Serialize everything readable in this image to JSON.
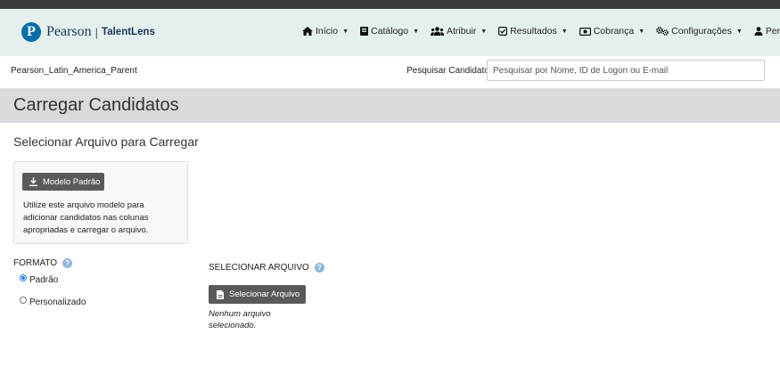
{
  "brand": {
    "name": "Pearson",
    "logo_letter": "P",
    "separator": "|",
    "product": "TalentLens"
  },
  "nav": {
    "items": [
      {
        "label": "Início",
        "icon": "home-icon"
      },
      {
        "label": "Catálogo",
        "icon": "book-icon"
      },
      {
        "label": "Atribuir",
        "icon": "users-icon"
      },
      {
        "label": "Resultados",
        "icon": "checkbox-icon"
      },
      {
        "label": "Cobrança",
        "icon": "money-icon"
      },
      {
        "label": "Configurações",
        "icon": "gears-icon"
      },
      {
        "label": "Perfil",
        "icon": "user-icon"
      }
    ]
  },
  "subbar": {
    "org_name": "Pearson_Latin_America_Parent",
    "search_label": "Pesquisar Candidatos",
    "search_placeholder": "Pesquisar por Nome, ID de Logon ou E-mail",
    "search_value": ""
  },
  "page": {
    "title": "Carregar Candidatos",
    "section_title": "Selecionar Arquivo para Carregar"
  },
  "template": {
    "button_label": "Modelo Padrão",
    "description": "Utilize este arquivo modelo para adicionar candidatos nas colunas apropriadas e carregar o arquivo."
  },
  "format": {
    "label": "FORMATO",
    "help": "?",
    "options": [
      {
        "label": "Padrão",
        "checked": true
      },
      {
        "label": "Personalizado",
        "checked": false
      }
    ]
  },
  "file_select": {
    "label": "SELECIONAR ARQUIVO",
    "help": "?",
    "button_label": "Selecionar Arquivo",
    "status": "Nenhum arquivo selecionado."
  },
  "colors": {
    "navbar_bg": "#e4f0ee",
    "header_bg": "#d9dade",
    "brand_blue": "#0a6ea8",
    "button_dark": "#5a5a5a",
    "help_icon": "#8fb8dd"
  }
}
